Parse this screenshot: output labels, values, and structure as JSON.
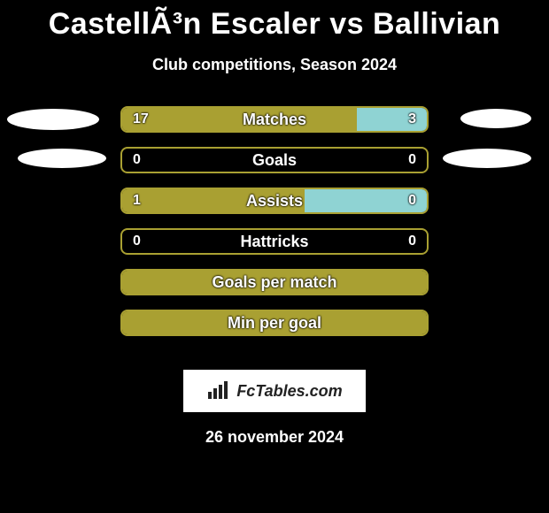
{
  "title": "CastellÃ³n Escaler vs Ballivian",
  "subtitle": "Club competitions, Season 2024",
  "stats": [
    {
      "label": "Matches",
      "left": "17",
      "right": "3",
      "left_pct": 77,
      "right_pct": 23
    },
    {
      "label": "Goals",
      "left": "0",
      "right": "0",
      "left_pct": 0,
      "right_pct": 0
    },
    {
      "label": "Assists",
      "left": "1",
      "right": "0",
      "left_pct": 60,
      "right_pct": 40
    },
    {
      "label": "Hattricks",
      "left": "0",
      "right": "0",
      "left_pct": 0,
      "right_pct": 0
    },
    {
      "label": "Goals per match",
      "left": "",
      "right": "",
      "left_pct": 100,
      "right_pct": 0
    },
    {
      "label": "Min per goal",
      "left": "",
      "right": "",
      "left_pct": 100,
      "right_pct": 0
    }
  ],
  "brand": "FcTables.com",
  "date": "26 november 2024",
  "chart_data": {
    "type": "bar",
    "title": "CastellÃ³n Escaler vs Ballivian — Club competitions, Season 2024",
    "categories": [
      "Matches",
      "Goals",
      "Assists",
      "Hattricks",
      "Goals per match",
      "Min per goal"
    ],
    "series": [
      {
        "name": "CastellÃ³n Escaler",
        "values": [
          17,
          0,
          1,
          0,
          null,
          null
        ]
      },
      {
        "name": "Ballivian",
        "values": [
          3,
          0,
          0,
          0,
          null,
          null
        ]
      }
    ],
    "xlabel": "",
    "ylabel": "",
    "ylim": null
  }
}
